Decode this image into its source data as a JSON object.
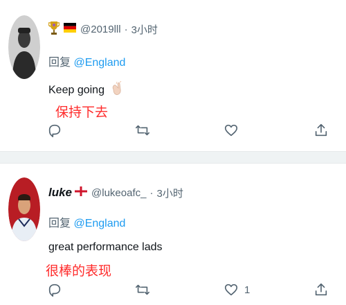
{
  "tweets": [
    {
      "handle": "@2019lll",
      "separator": "·",
      "time": "3小时",
      "reply_prefix": "回复",
      "reply_mention": "@England",
      "text": "Keep going",
      "translation": "保持下去",
      "like_count": ""
    },
    {
      "display_name": "luke",
      "handle": "@lukeoafc_",
      "separator": "·",
      "time": "3小时",
      "reply_prefix": "回复",
      "reply_mention": "@England",
      "text": "great performance lads",
      "translation": "很棒的表现",
      "like_count": "1"
    }
  ],
  "icons": {
    "reply": "reply-icon",
    "retweet": "retweet-icon",
    "like": "like-icon",
    "share": "share-icon",
    "clap": "clapping-hands-icon",
    "germany_flag": "germany-flag-icon",
    "england_flag": "england-flag-icon",
    "trophy": "trophy-icon"
  },
  "colors": {
    "mention": "#1d9bf0",
    "muted": "#536471",
    "translation": "#ff2a2a",
    "divider": "#eff3f4"
  }
}
